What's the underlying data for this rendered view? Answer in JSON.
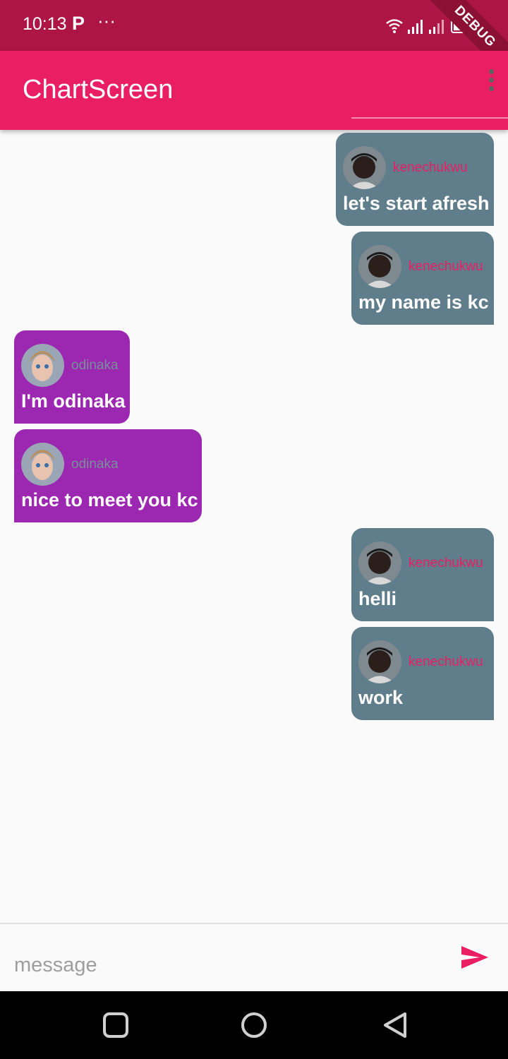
{
  "status_bar": {
    "time": "10:13",
    "notification_letter": "P",
    "overflow_indicator": "···",
    "debug_banner": "DEBUG",
    "icons": [
      "wifi-icon",
      "signal-icon",
      "signal-icon",
      "battery-charging-icon"
    ]
  },
  "app_bar": {
    "title": "ChartScreen",
    "menu_icon": "more-vert-icon",
    "color": "#e91e63"
  },
  "messages": [
    {
      "sender": "kenechukwu",
      "text": "let's start afresh",
      "side": "right"
    },
    {
      "sender": "kenechukwu",
      "text": "my name is kc",
      "side": "right"
    },
    {
      "sender": "odinaka",
      "text": "I'm odinaka",
      "side": "left"
    },
    {
      "sender": "odinaka",
      "text": "nice to meet you kc",
      "side": "left"
    },
    {
      "sender": "kenechukwu",
      "text": "helli",
      "side": "right"
    },
    {
      "sender": "kenechukwu",
      "text": "work",
      "side": "right"
    }
  ],
  "composer": {
    "placeholder": "message",
    "value": "",
    "send_icon": "send-icon"
  },
  "colors": {
    "mine_bubble": "#607d8b",
    "theirs_bubble": "#9c27b0",
    "accent": "#e91e63",
    "status_bar": "#ad1547"
  },
  "nav_bar": {
    "icons": [
      "square-icon",
      "circle-icon",
      "back-triangle-icon"
    ]
  }
}
